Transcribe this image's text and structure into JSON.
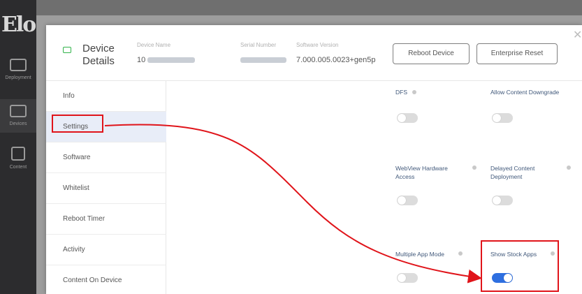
{
  "app": {
    "logo": "Elo",
    "nav": [
      {
        "label": "Deployment",
        "icon": "monitor-icon"
      },
      {
        "label": "Devices",
        "icon": "devices-icon"
      },
      {
        "label": "Content",
        "icon": "content-grid-icon"
      }
    ]
  },
  "modal": {
    "title": "Device Details",
    "close_icon": "close-icon",
    "fields": {
      "device_name_label": "Device Name",
      "device_name_value": "10",
      "serial_number_label": "Serial Number",
      "software_version_label": "Software Version",
      "software_version_value": "7.000.005.0023+gen5p"
    },
    "buttons": {
      "reboot": "Reboot Device",
      "enterprise_reset": "Enterprise Reset"
    },
    "menu": [
      {
        "label": "Info",
        "active": false
      },
      {
        "label": "Settings",
        "active": true
      },
      {
        "label": "Software",
        "active": false
      },
      {
        "label": "Whitelist",
        "active": false
      },
      {
        "label": "Reboot Timer",
        "active": false
      },
      {
        "label": "Activity",
        "active": false
      },
      {
        "label": "Content On Device",
        "active": false
      }
    ],
    "settings": [
      {
        "label": "DFS",
        "on": false
      },
      {
        "label": "Allow Content Downgrade",
        "on": false
      },
      {
        "label": "WebView Hardware Access",
        "on": false
      },
      {
        "label": "Delayed Content Deployment",
        "on": false
      },
      {
        "label": "Multiple App Mode",
        "on": false
      },
      {
        "label": "Show Stock Apps",
        "on": true
      }
    ]
  },
  "colors": {
    "highlight": "#e0141a",
    "toggle_on": "#2e6fe0",
    "device_icon": "#31b34a"
  }
}
